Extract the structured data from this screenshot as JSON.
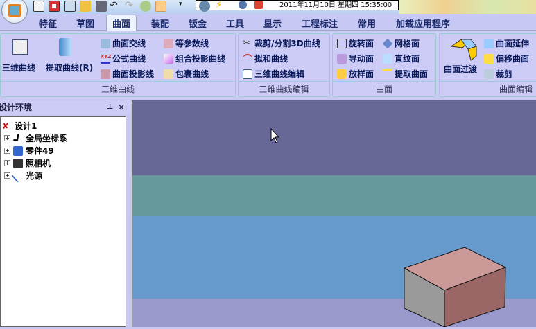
{
  "datetime": "2011年11月10日 星期四 15:35:00",
  "tabs": [
    "特征",
    "草图",
    "曲面",
    "装配",
    "钣金",
    "工具",
    "显示",
    "工程标注",
    "常用",
    "加载应用程序"
  ],
  "active_tab": "曲面",
  "groups": {
    "curve3d": {
      "label": "三维曲线",
      "big": [
        "三维曲线",
        "提取曲线(R)"
      ],
      "items": [
        "曲面交线",
        "公式曲线",
        "曲面投影线",
        "等参数线",
        "组合投影曲线",
        "包裹曲线"
      ]
    },
    "curveedit": {
      "label": "三维曲线编辑",
      "items": [
        "裁剪/分割3D曲线",
        "拟和曲线",
        "三维曲线编辑"
      ]
    },
    "surface": {
      "label": "曲面",
      "items": [
        "旋转面",
        "导动面",
        "放样面",
        "网格面",
        "直纹面",
        "提取曲面"
      ]
    },
    "surfedit": {
      "label": "曲面编辑",
      "big": "曲面过渡",
      "items": [
        "曲面延伸",
        "偏移曲面",
        "裁剪"
      ]
    }
  },
  "panel": {
    "title": "设计环境",
    "pin": "⊥",
    "close": "✕"
  },
  "tree": {
    "root": "设计1",
    "children": [
      "全局坐标系",
      "零件49",
      "照相机",
      "光源"
    ]
  },
  "colors": {
    "view_top": "#686898",
    "teal": "#669999",
    "blue": "#6699cc",
    "floor": "#9999cc"
  }
}
